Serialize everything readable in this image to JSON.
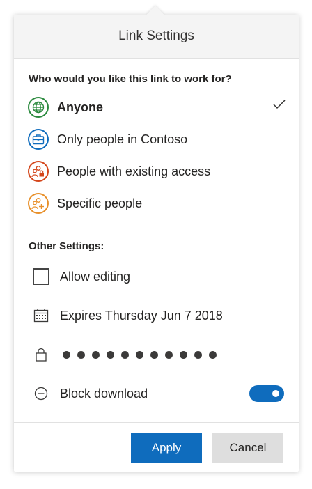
{
  "header": {
    "title": "Link Settings"
  },
  "who": {
    "title": "Who would you like this link to work for?",
    "options": [
      {
        "label": "Anyone",
        "icon": "globe-icon",
        "color": "#2b8a3e",
        "selected": true
      },
      {
        "label": "Only people in Contoso",
        "icon": "briefcase-icon",
        "color": "#0f6cbd",
        "selected": false
      },
      {
        "label": "People with existing access",
        "icon": "people-lock-icon",
        "color": "#d4461b",
        "selected": false
      },
      {
        "label": "Specific people",
        "icon": "people-add-icon",
        "color": "#e8902a",
        "selected": false
      }
    ]
  },
  "other": {
    "title": "Other Settings:",
    "allow_editing": {
      "label": "Allow editing",
      "checked": false
    },
    "expires": {
      "label": "Expires Thursday Jun 7 2018",
      "icon": "calendar-icon"
    },
    "password": {
      "dot_count": 11,
      "icon": "lock-icon"
    },
    "block_download": {
      "label": "Block download",
      "icon": "minus-circle-icon",
      "enabled": true
    }
  },
  "actions": {
    "apply_label": "Apply",
    "cancel_label": "Cancel"
  }
}
